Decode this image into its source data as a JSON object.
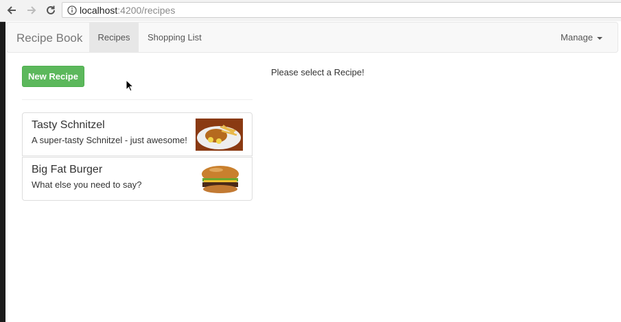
{
  "browser": {
    "url_host": "localhost",
    "url_path": ":4200/recipes",
    "icons": [
      "back-arrow-icon",
      "forward-arrow-icon",
      "reload-icon",
      "info-icon"
    ]
  },
  "navbar": {
    "brand": "Recipe Book",
    "links": [
      {
        "label": "Recipes",
        "active": true
      },
      {
        "label": "Shopping List",
        "active": false
      }
    ],
    "manage_label": "Manage"
  },
  "sidebar": {
    "new_recipe_label": "New Recipe",
    "recipes": [
      {
        "name": "Tasty Schnitzel",
        "description": "A super-tasty Schnitzel - just awesome!"
      },
      {
        "name": "Big Fat Burger",
        "description": "What else you need to say?"
      }
    ]
  },
  "main": {
    "message": "Please select a Recipe!"
  },
  "colors": {
    "success": "#5cb85c",
    "navbar_bg": "#f8f8f8",
    "active_nav": "#e7e7e7"
  }
}
